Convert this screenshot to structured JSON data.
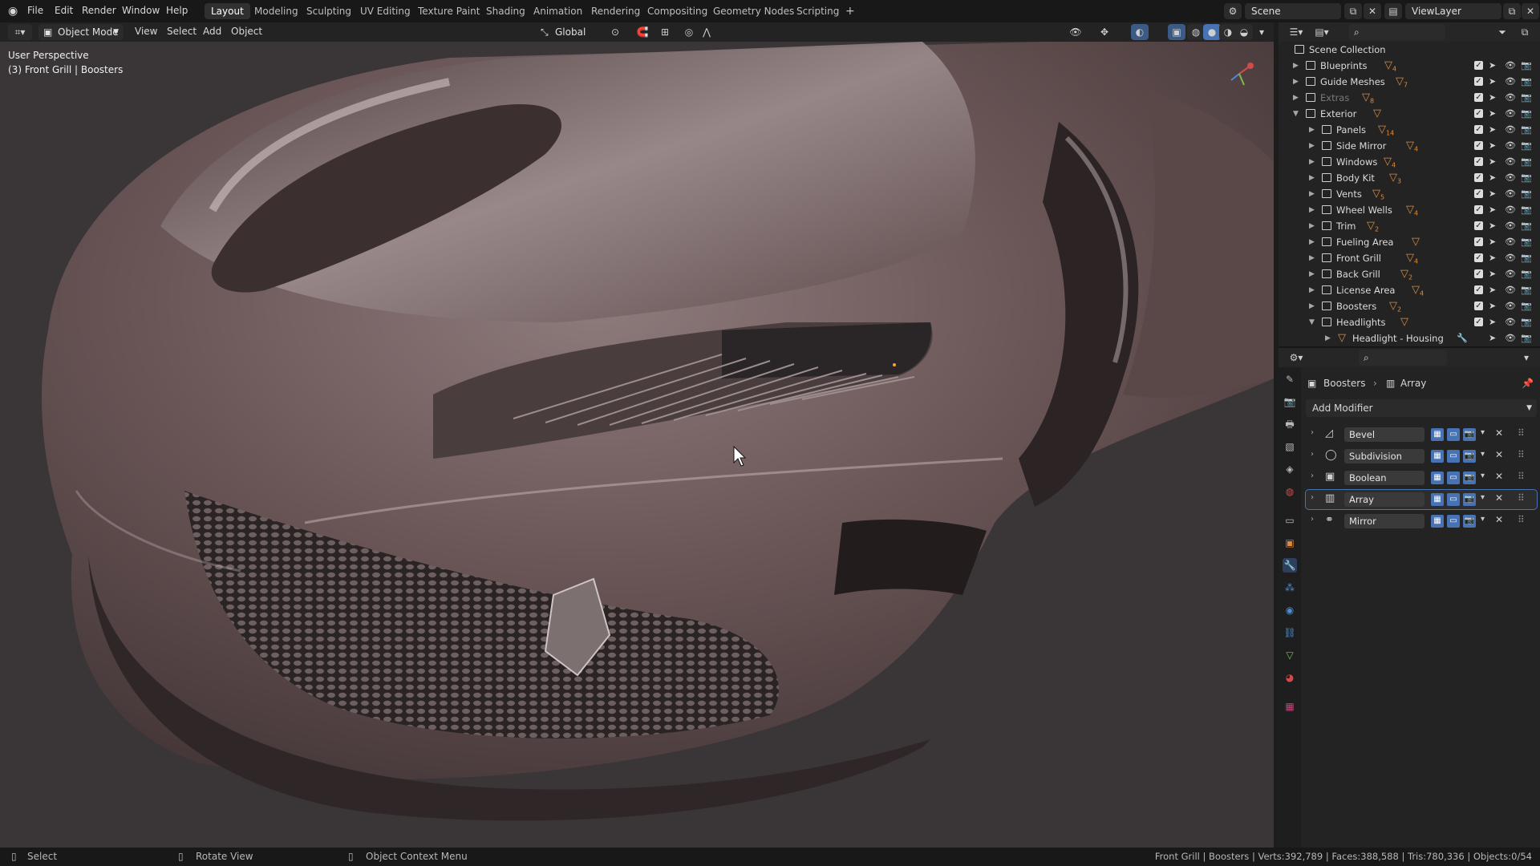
{
  "menu": {
    "items": [
      "File",
      "Edit",
      "Render",
      "Window",
      "Help"
    ]
  },
  "workspaces": {
    "tabs": [
      "Layout",
      "Modeling",
      "Sculpting",
      "UV Editing",
      "Texture Paint",
      "Shading",
      "Animation",
      "Rendering",
      "Compositing",
      "Geometry Nodes",
      "Scripting"
    ],
    "active": "Layout",
    "add_label": "+"
  },
  "scene": {
    "name": "Scene",
    "view_layer": "ViewLayer"
  },
  "viewport": {
    "mode": "Object Mode",
    "menus": [
      "View",
      "Select",
      "Add",
      "Object"
    ],
    "orientation": "Global",
    "overlay_title": "User Perspective",
    "overlay_subtitle": "(3) Front Grill | Boosters"
  },
  "outliner": {
    "root": "Scene Collection",
    "rows": [
      {
        "label": "Blueprints",
        "count": "4",
        "depth": 1,
        "expanded": false,
        "dim": false
      },
      {
        "label": "Guide Meshes",
        "count": "7",
        "depth": 1,
        "expanded": false,
        "dim": false
      },
      {
        "label": "Extras",
        "count": "8",
        "depth": 1,
        "expanded": false,
        "dim": true
      },
      {
        "label": "Exterior",
        "count": "",
        "depth": 1,
        "expanded": true,
        "dim": false
      },
      {
        "label": "Panels",
        "count": "14",
        "depth": 2,
        "expanded": false,
        "dim": false
      },
      {
        "label": "Side Mirror",
        "count": "4",
        "depth": 2,
        "expanded": false,
        "dim": false
      },
      {
        "label": "Windows",
        "count": "4",
        "depth": 2,
        "expanded": false,
        "dim": false
      },
      {
        "label": "Body Kit",
        "count": "3",
        "depth": 2,
        "expanded": false,
        "dim": false
      },
      {
        "label": "Vents",
        "count": "5",
        "depth": 2,
        "expanded": false,
        "dim": false
      },
      {
        "label": "Wheel Wells",
        "count": "4",
        "depth": 2,
        "expanded": false,
        "dim": false
      },
      {
        "label": "Trim",
        "count": "2",
        "depth": 2,
        "expanded": false,
        "dim": false
      },
      {
        "label": "Fueling Area",
        "count": "",
        "depth": 2,
        "expanded": false,
        "dim": false
      },
      {
        "label": "Front Grill",
        "count": "4",
        "depth": 2,
        "expanded": false,
        "dim": false
      },
      {
        "label": "Back Grill",
        "count": "2",
        "depth": 2,
        "expanded": false,
        "dim": false
      },
      {
        "label": "License Area",
        "count": "4",
        "depth": 2,
        "expanded": false,
        "dim": false
      },
      {
        "label": "Boosters",
        "count": "2",
        "depth": 2,
        "expanded": false,
        "dim": false
      },
      {
        "label": "Headlights",
        "count": "",
        "depth": 2,
        "expanded": true,
        "dim": false
      },
      {
        "label": "Headlight - Housing",
        "count": "",
        "depth": 3,
        "expanded": false,
        "dim": false
      }
    ]
  },
  "properties": {
    "breadcrumb_object": "Boosters",
    "breadcrumb_modifier": "Array",
    "add_modifier_label": "Add Modifier",
    "modifiers": [
      {
        "name": "Bevel",
        "active": false
      },
      {
        "name": "Subdivision",
        "active": false
      },
      {
        "name": "Boolean",
        "active": false
      },
      {
        "name": "Array",
        "active": true
      },
      {
        "name": "Mirror",
        "active": false
      }
    ]
  },
  "statusbar": {
    "select": "Select",
    "rotate": "Rotate View",
    "context": "Object Context Menu",
    "stats": "Front Grill | Boosters | Verts:392,789 | Faces:388,588 | Tris:780,336 | Objects:0/54"
  },
  "colors": {
    "accent": "#4772b3",
    "count_icon": "#e08a3c",
    "car_body": "#5c4a4b"
  }
}
